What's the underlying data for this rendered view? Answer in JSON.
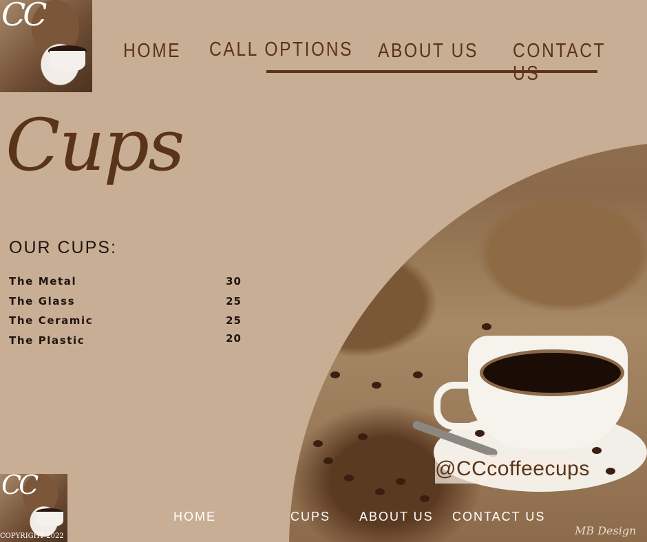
{
  "brand": {
    "logo_text": "CC"
  },
  "nav_top": {
    "items": [
      "HOME",
      "CALL OPTIONS",
      "ABOUT US",
      "CONTACT US"
    ]
  },
  "page": {
    "title": "Cups",
    "section_title": "OUR CUPS:"
  },
  "cups": [
    {
      "name": "The Metal",
      "price": "30"
    },
    {
      "name": "The Glass",
      "price": "25"
    },
    {
      "name": "The Ceramic",
      "price": "25"
    },
    {
      "name": "The Plastic",
      "price": "20"
    }
  ],
  "social": {
    "handle": "@CCcoffeecups"
  },
  "footer": {
    "copyright": "COPYRIGHT 2022",
    "nav": [
      "HOME",
      "CUPS",
      "ABOUT US",
      "CONTACT US"
    ],
    "credit": "MB Design"
  },
  "colors": {
    "background": "#c9ae96",
    "brand_brown": "#5a3418",
    "text_dark": "#1f150f"
  }
}
